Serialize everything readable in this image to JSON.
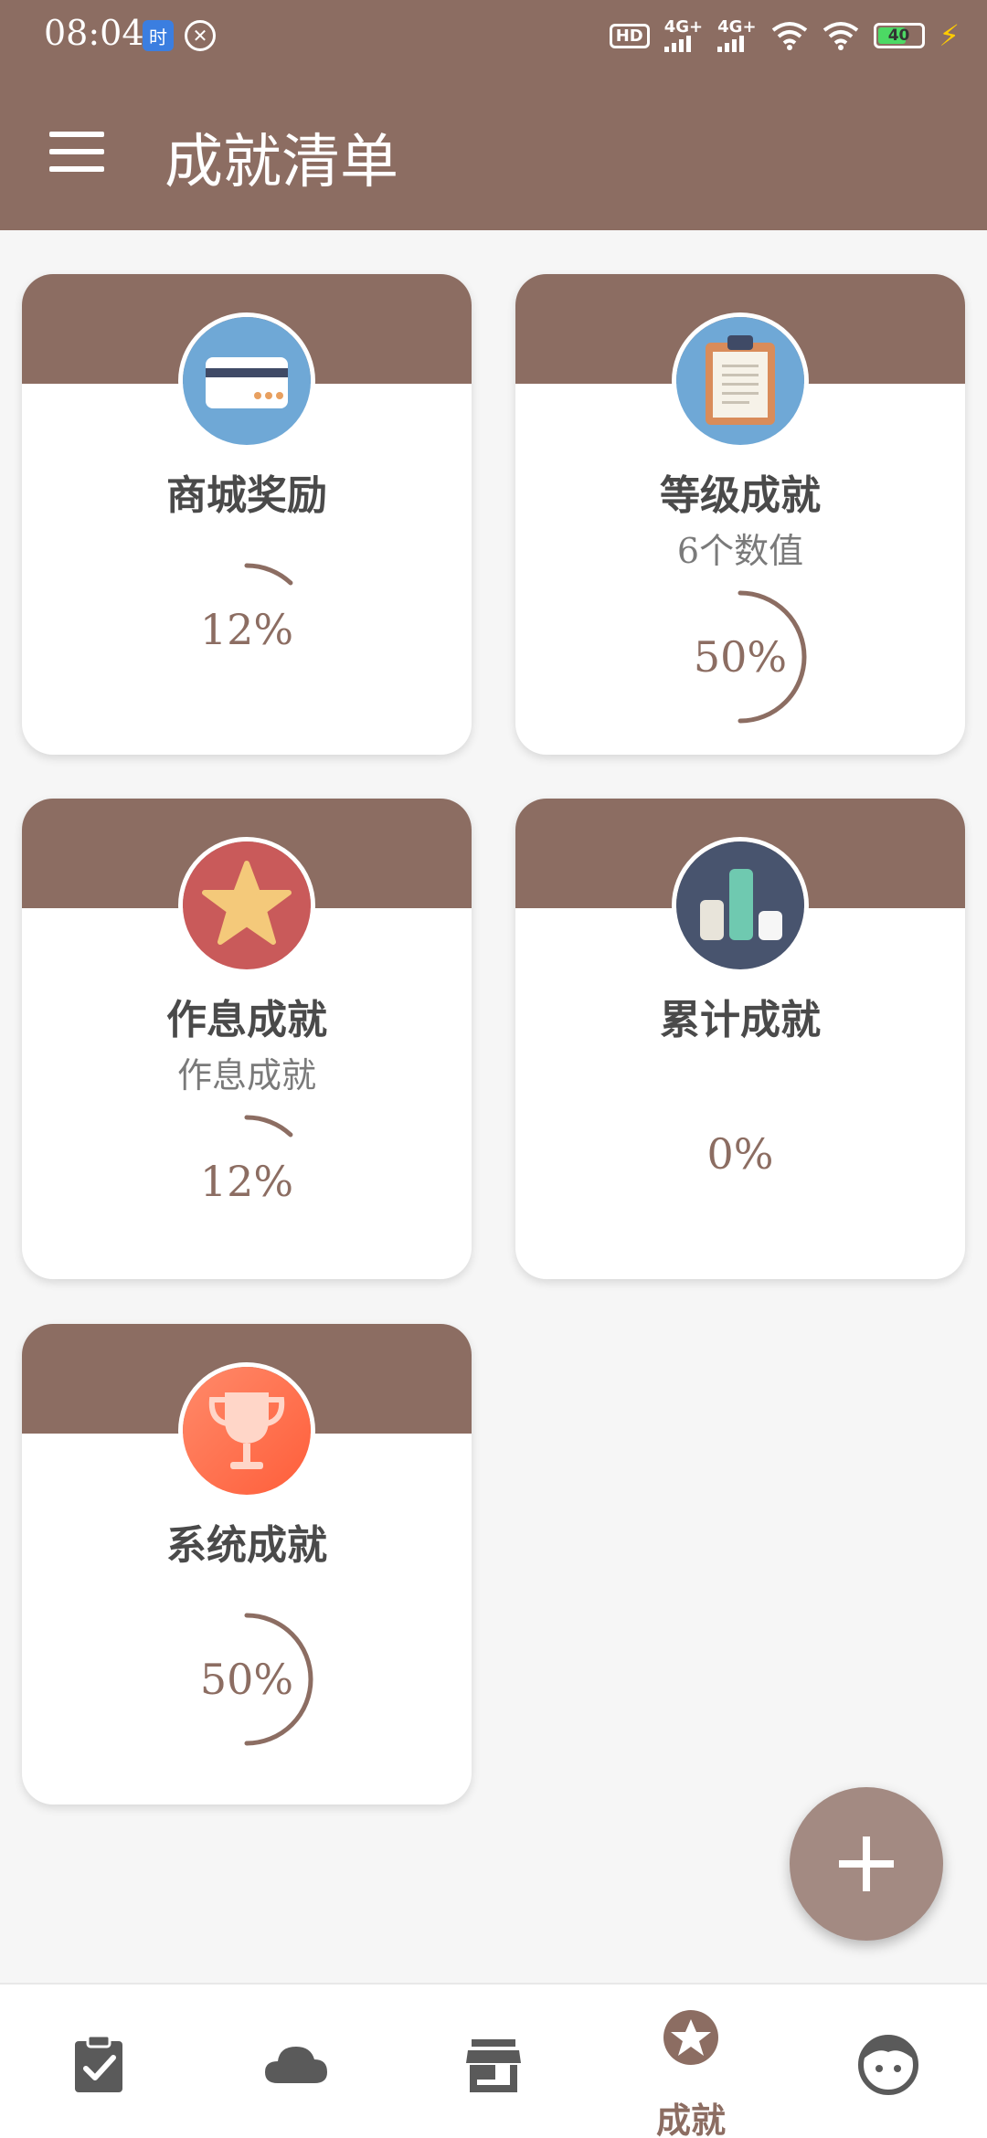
{
  "status_bar": {
    "time": "08:04",
    "badge_label": "时",
    "hd_label": "HD",
    "net1_label": "4G+",
    "net2_label": "4G+",
    "battery_level": "40"
  },
  "app_bar": {
    "title": "成就清单"
  },
  "cards": [
    {
      "title": "商城奖励",
      "subtitle": "",
      "percent_label": "12%",
      "progress": 0.12,
      "icon": "credit-card-icon"
    },
    {
      "title": "等级成就",
      "subtitle": "6个数值",
      "percent_label": "50%",
      "progress": 0.5,
      "icon": "clipboard-icon"
    },
    {
      "title": "作息成就",
      "subtitle": "作息成就",
      "percent_label": "12%",
      "progress": 0.12,
      "icon": "star-icon"
    },
    {
      "title": "累计成就",
      "subtitle": "",
      "percent_label": "0%",
      "progress": 0.0,
      "icon": "bar-chart-icon"
    },
    {
      "title": "系统成就",
      "subtitle": "",
      "percent_label": "50%",
      "progress": 0.5,
      "icon": "trophy-icon"
    }
  ],
  "bottom_nav": {
    "items": [
      {
        "icon": "clipboard-check-icon",
        "label": ""
      },
      {
        "icon": "cloud-icon",
        "label": ""
      },
      {
        "icon": "store-icon",
        "label": ""
      },
      {
        "icon": "star-badge-icon",
        "label": "成就"
      },
      {
        "icon": "face-icon",
        "label": ""
      }
    ],
    "active_index": 3
  },
  "fab": {
    "icon": "plus-icon"
  },
  "colors": {
    "primary": "#8c6d62",
    "fab": "#a38a82",
    "background": "#f6f6f6"
  }
}
